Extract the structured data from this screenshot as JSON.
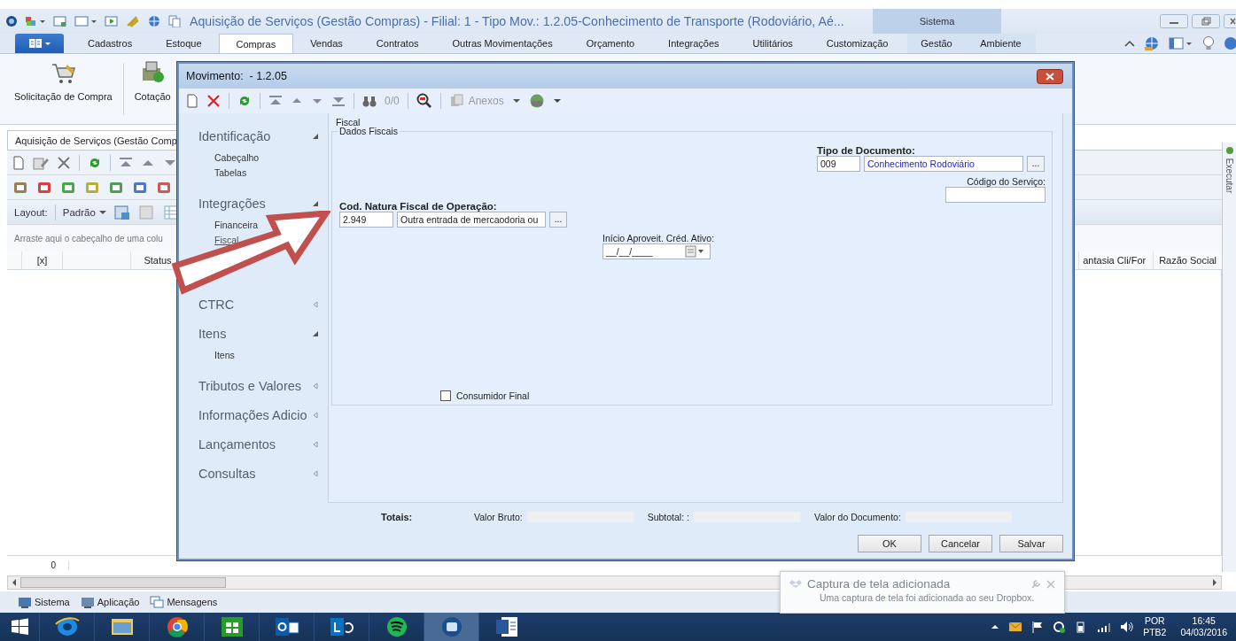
{
  "window": {
    "title": "Aquisição de Serviços (Gestão Compras) - Filial: 1 - Tipo Mov.: 1.2.05-Conhecimento de Transporte (Rodoviário, Aé...",
    "context_group": "Sistema"
  },
  "ribbon": {
    "tabs": [
      {
        "label": "Cadastros",
        "selected": false
      },
      {
        "label": "Estoque",
        "selected": false
      },
      {
        "label": "Compras",
        "selected": true
      },
      {
        "label": "Vendas",
        "selected": false
      },
      {
        "label": "Contratos",
        "selected": false
      },
      {
        "label": "Outras Movimentações",
        "selected": false
      },
      {
        "label": "Orçamento",
        "selected": false
      },
      {
        "label": "Integrações",
        "selected": false
      },
      {
        "label": "Utilitários",
        "selected": false
      },
      {
        "label": "Customização",
        "selected": false
      }
    ],
    "context_tabs": [
      {
        "label": "Gestão",
        "selected": false
      },
      {
        "label": "Ambiente",
        "selected": false
      }
    ],
    "buttons": [
      {
        "label": "Solicitação de Compra",
        "kind": "cart"
      },
      {
        "label": "Cotação",
        "kind": "quote"
      }
    ]
  },
  "document_tab": "Aquisição de Serviços (Gestão Comp",
  "layout_bar": {
    "label": "Layout:",
    "value": "Padrão"
  },
  "group_hint": "Arraste aqui o cabeçalho de uma colu",
  "grid": {
    "columns_left": [
      "[x]",
      "Status"
    ],
    "columns_right": [
      "antasia Cli/For",
      "Razão Social"
    ],
    "footer": "0"
  },
  "side_action": "Executar",
  "bottom_tabs": [
    "Sistema",
    "Aplicação",
    "Mensagens"
  ],
  "dialog": {
    "title": "Movimento:  - 1.2.05",
    "counter": "0/0",
    "attachments": "Anexos",
    "nav": [
      {
        "label": "Identificação",
        "expanded": true,
        "children": [
          {
            "label": "Cabeçalho",
            "selected": false
          },
          {
            "label": "Tabelas",
            "selected": false
          }
        ]
      },
      {
        "label": "Integrações",
        "expanded": true,
        "children": [
          {
            "label": "Financeira",
            "selected": false
          },
          {
            "label": "Fiscal",
            "selected": true
          }
        ]
      },
      {
        "label": "CTRC",
        "expanded": false
      },
      {
        "label": "Itens",
        "expanded": true,
        "children": [
          {
            "label": "Itens",
            "selected": false
          }
        ]
      },
      {
        "label": "Tributos e Valores",
        "expanded": false
      },
      {
        "label": "Informações Adicio",
        "expanded": false
      },
      {
        "label": "Lançamentos",
        "expanded": false
      },
      {
        "label": "Consultas",
        "expanded": false
      }
    ],
    "page_title": "Fiscal",
    "section": "Dados Fiscais",
    "document_type": {
      "label": "Tipo de Documento:",
      "code": "009",
      "name": "Conhecimento Rodoviário",
      "lookup": "..."
    },
    "service_code": {
      "label": "Código do Serviço:"
    },
    "fiscal_nature": {
      "label": "Cod. Natura Fiscal de Operação:",
      "code": "2.949",
      "name": "Outra entrada de mercaodoria ou",
      "lookup": "..."
    },
    "credit_start": {
      "label": "Início Aproveit. Créd. Ativo:",
      "value": "__/__/____"
    },
    "final_consumer": {
      "label": "Consumidor Final",
      "checked": false
    },
    "totals": {
      "label": "Totais:",
      "items": [
        "Valor Bruto:",
        "Subtotal: :",
        "Valor do Documento:"
      ]
    },
    "buttons": [
      "OK",
      "Cancelar",
      "Salvar"
    ]
  },
  "notification": {
    "title": "Captura de tela adicionada",
    "message": "Uma captura de tela foi adicionada ao seu Dropbox."
  },
  "taskbar": {
    "apps": [
      {
        "kind": "ie",
        "selected": false
      },
      {
        "kind": "folder",
        "selected": false
      },
      {
        "kind": "chrome",
        "selected": false
      },
      {
        "kind": "store",
        "selected": false
      },
      {
        "kind": "outlook",
        "selected": false
      },
      {
        "kind": "lync",
        "selected": false
      },
      {
        "kind": "spotify",
        "selected": false
      },
      {
        "kind": "erp",
        "selected": true
      },
      {
        "kind": "word",
        "selected": false
      }
    ],
    "language": "POR",
    "layout": "PTB2",
    "time": "16:45",
    "date": "04/03/2016"
  }
}
